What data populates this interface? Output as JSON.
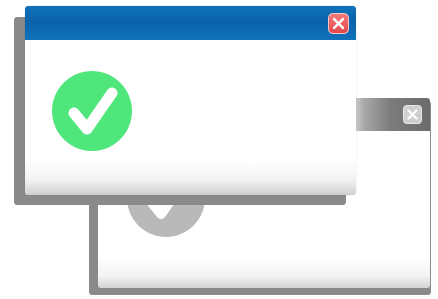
{
  "dialogs": {
    "back": {
      "state": "inactive",
      "titlebar_color": "#6b6b6b",
      "close_icon": "close-icon",
      "status_icon": "checkmark-icon",
      "status_color": "#b9b9b9"
    },
    "front": {
      "state": "active",
      "titlebar_color": "#0b62ab",
      "close_icon": "close-icon",
      "close_color": "#e2474b",
      "status_icon": "checkmark-icon",
      "status_color": "#4fe67c"
    }
  }
}
